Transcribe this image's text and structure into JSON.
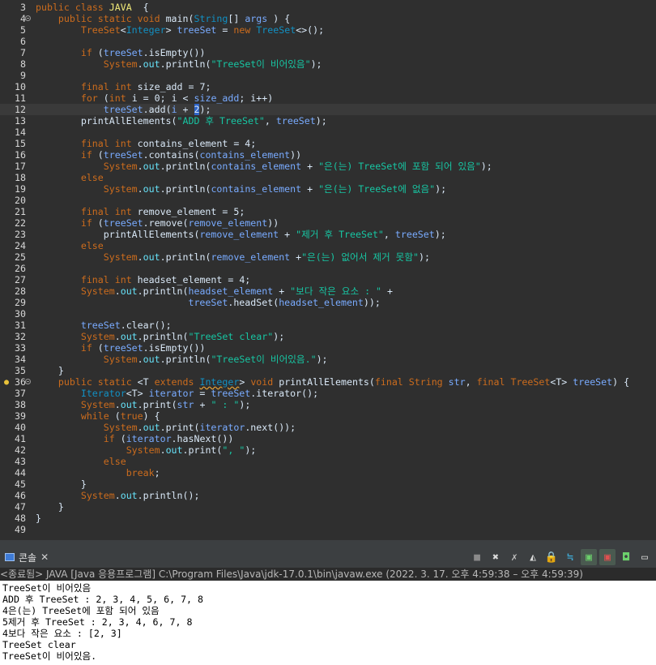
{
  "editor": {
    "line_numbers": [
      "3",
      "4",
      "5",
      "6",
      "7",
      "8",
      "9",
      "10",
      "11",
      "12",
      "13",
      "14",
      "15",
      "16",
      "17",
      "18",
      "19",
      "20",
      "21",
      "22",
      "23",
      "24",
      "25",
      "26",
      "27",
      "28",
      "29",
      "30",
      "31",
      "32",
      "33",
      "34",
      "35",
      "36",
      "37",
      "38",
      "39",
      "40",
      "41",
      "42",
      "43",
      "44",
      "45",
      "46",
      "47",
      "48",
      "49"
    ],
    "code": {
      "l3": {
        "k1": "public",
        "k2": "class",
        "cls": "JAVA",
        "rest": "  {"
      },
      "l4": {
        "k1": "public",
        "k2": "static",
        "k3": "void",
        "m": "main(",
        "t": "String",
        "b": "[] ",
        "p": "args",
        "e": " ) {"
      },
      "l5": {
        "t1": "TreeSet",
        "a": "<",
        "t2": "Integer",
        "b": "> ",
        "v": "treeSet",
        "c": " = ",
        "k": "new",
        "d": " ",
        "t3": "TreeSet",
        "e": "<>();"
      },
      "l7": {
        "k": "if",
        "a": " (",
        "v": "treeSet",
        "c": ".",
        "m": "isEmpty",
        "e": "())"
      },
      "l8": {
        "s": "System",
        "a": ".",
        "f": "out",
        "b": ".",
        "m": "println",
        "c": "(",
        "str": "\"TreeSet이 비어있음\"",
        "e": ");"
      },
      "l10": {
        "k1": "final",
        "k2": "int",
        "a": " size_add = ",
        "n": "7",
        "e": ";"
      },
      "l11": {
        "k1": "for",
        "a": " (",
        "k2": "int",
        "b": " i = ",
        "n": "0",
        "c": "; i < ",
        "v": "size_add",
        "e": "; i++)"
      },
      "l12": {
        "v": "treeSet",
        "a": ".",
        "m": "add",
        "b": "(",
        "i": "i",
        "c": " + ",
        "sel": "2",
        "e": ");"
      },
      "l13": {
        "m": "printAllElements",
        "a": "(",
        "str": "\"ADD 후 TreeSet\"",
        "b": ", ",
        "v": "treeSet",
        "e": ");"
      },
      "l15": {
        "k1": "final",
        "k2": "int",
        "a": " contains_element = ",
        "n": "4",
        "e": ";"
      },
      "l16": {
        "k": "if",
        "a": " (",
        "v": "treeSet",
        "b": ".",
        "m": "contains",
        "c": "(",
        "v2": "contains_element",
        "e": "))"
      },
      "l17": {
        "s": "System",
        "a": ".",
        "f": "out",
        "b": ".",
        "m": "println",
        "c": "(",
        "v": "contains_element",
        "d": " + ",
        "str": "\"은(는) TreeSet에 포함 되어 있음\"",
        "e": ");"
      },
      "l18": {
        "k": "else"
      },
      "l19": {
        "s": "System",
        "a": ".",
        "f": "out",
        "b": ".",
        "m": "println",
        "c": "(",
        "v": "contains_element",
        "d": " + ",
        "str": "\"은(는) TreeSet에 없음\"",
        "e": ");"
      },
      "l21": {
        "k1": "final",
        "k2": "int",
        "a": " remove_element = ",
        "n": "5",
        "e": ";"
      },
      "l22": {
        "k": "if",
        "a": " (",
        "v": "treeSet",
        "b": ".",
        "m": "remove",
        "c": "(",
        "v2": "remove_element",
        "e": "))"
      },
      "l23": {
        "m": "printAllElements",
        "a": "(",
        "v": "remove_element",
        "d": " + ",
        "str": "\"제거 후 TreeSet\"",
        "b": ", ",
        "v2": "treeSet",
        "e": ");"
      },
      "l24": {
        "k": "else"
      },
      "l25": {
        "s": "System",
        "a": ".",
        "f": "out",
        "b": ".",
        "m": "println",
        "c": "(",
        "v": "remove_element",
        "d": " +",
        "str": "\"은(는) 없어서 제거 못함\"",
        "e": ");"
      },
      "l27": {
        "k1": "final",
        "k2": "int",
        "a": " headset_element = ",
        "n": "4",
        "e": ";"
      },
      "l28": {
        "s": "System",
        "a": ".",
        "f": "out",
        "b": ".",
        "m": "println",
        "c": "(",
        "v": "headset_element",
        "d": " + ",
        "str": "\"보다 작은 요소 : \"",
        "e": " +"
      },
      "l29": {
        "v": "treeSet",
        "a": ".",
        "m": "headSet",
        "c": "(",
        "v2": "headset_element",
        "e": "));"
      },
      "l31": {
        "v": "treeSet",
        "a": ".",
        "m": "clear",
        "e": "();"
      },
      "l32": {
        "s": "System",
        "a": ".",
        "f": "out",
        "b": ".",
        "m": "println",
        "c": "(",
        "str": "\"TreeSet clear\"",
        "e": ");"
      },
      "l33": {
        "k": "if",
        "a": " (",
        "v": "treeSet",
        "c": ".",
        "m": "isEmpty",
        "e": "())"
      },
      "l34": {
        "s": "System",
        "a": ".",
        "f": "out",
        "b": ".",
        "m": "println",
        "c": "(",
        "str": "\"TreeSet이 비어있음.\"",
        "e": ");"
      },
      "l35": {
        "e": "}"
      },
      "l36": {
        "k1": "public",
        "k2": "static",
        "a": " <T ",
        "k3": "extends",
        "b": " ",
        "t": "Integer",
        "c": "> ",
        "k4": "void",
        "d": " ",
        "m": "printAllElements",
        "f": "(",
        "k5": "final",
        "g": " ",
        "t2": "String",
        "h": " ",
        "v": "str",
        "i": ", ",
        "k6": "final",
        "j": " ",
        "t3": "TreeSet",
        "l": "<T> ",
        "v2": "treeSet",
        "e": ") {"
      },
      "l37": {
        "t": "Iterator",
        "a": "<T> ",
        "v": "iterator",
        "b": " = ",
        "v2": "treeSet",
        "c": ".",
        "m": "iterator",
        "e": "();"
      },
      "l38": {
        "s": "System",
        "a": ".",
        "f": "out",
        "b": ".",
        "m": "print",
        "c": "(",
        "v": "str",
        "d": " + ",
        "str": "\" : \"",
        "e": ");"
      },
      "l39": {
        "k1": "while",
        "a": " (",
        "k2": "true",
        "e": ") {"
      },
      "l40": {
        "s": "System",
        "a": ".",
        "f": "out",
        "b": ".",
        "m": "print",
        "c": "(",
        "v": "iterator",
        "d": ".",
        "m2": "next",
        "e": "());"
      },
      "l41": {
        "k": "if",
        "a": " (",
        "v": "iterator",
        "c": ".",
        "m": "hasNext",
        "e": "())"
      },
      "l42": {
        "s": "System",
        "a": ".",
        "f": "out",
        "b": ".",
        "m": "print",
        "c": "(",
        "str": "\", \"",
        "e": ");"
      },
      "l43": {
        "k": "else"
      },
      "l44": {
        "k": "break",
        "e": ";"
      },
      "l45": {
        "e": "}"
      },
      "l46": {
        "s": "System",
        "a": ".",
        "f": "out",
        "b": ".",
        "m": "println",
        "e": "();"
      },
      "l47": {
        "e": "}"
      },
      "l48": {
        "e": "}"
      }
    }
  },
  "console": {
    "tab_label": "콘솔",
    "status": "<종료됨> JAVA [Java 응용프로그램] C:\\Program Files\\Java\\jdk-17.0.1\\bin\\javaw.exe (2022. 3. 17. 오후 4:59:38 – 오후 4:59:39)",
    "output": [
      "TreeSet이 비어있음",
      "ADD 후 TreeSet : 2, 3, 4, 5, 6, 7, 8",
      "4은(는) TreeSet에 포함 되어 있음",
      "5제거 후 TreeSet : 2, 3, 4, 6, 7, 8",
      "4보다 작은 요소 : [2, 3]",
      "TreeSet clear",
      "TreeSet이 비어있음."
    ],
    "toolbar_icons": [
      "stop-icon",
      "remove-launch-icon",
      "remove-all-launches-icon",
      "clear-console-icon",
      "scroll-lock-icon",
      "word-wrap-icon",
      "show-on-stdout-icon",
      "show-on-stderr-icon",
      "pin-console-icon",
      "display-console-icon"
    ]
  },
  "colors": {
    "editor_bg": "#2f2f2f",
    "keyword": "#cc6c1d",
    "string": "#17c6a3",
    "field": "#66e1f8",
    "method": "#a7ec21",
    "type": "#1290c3",
    "selection": "#2f65ca"
  }
}
